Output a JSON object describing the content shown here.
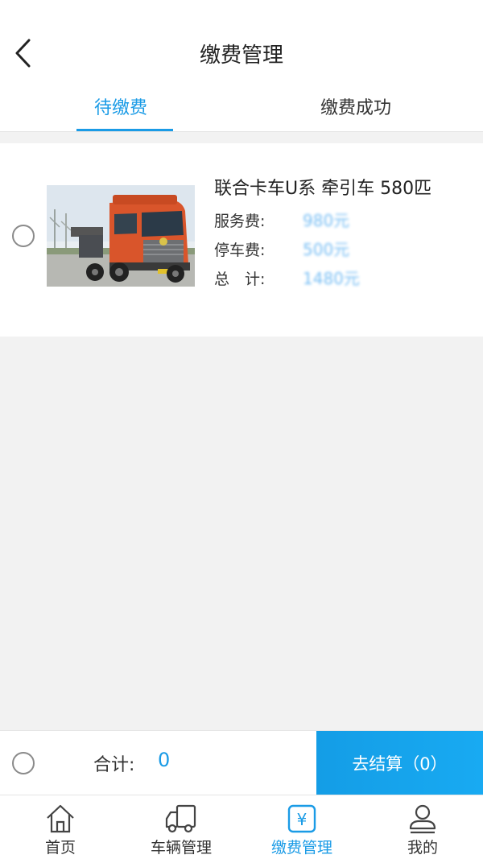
{
  "header": {
    "title": "缴费管理",
    "back_icon": "chevron-left-icon"
  },
  "tabs": [
    {
      "label": "待缴费",
      "active": true
    },
    {
      "label": "缴费成功",
      "active": false
    }
  ],
  "item": {
    "title": "联合卡车U系 牵引车 580匹",
    "image": "truck-photo",
    "fees": [
      {
        "label": "服务费:",
        "value": "980元"
      },
      {
        "label": "停车费:",
        "value": "500元"
      },
      {
        "label": "总　计:",
        "value": "1480元"
      }
    ]
  },
  "checkout": {
    "total_label": "合计:",
    "total_value": "0",
    "button_label": "去结算（0）"
  },
  "bottom_nav": [
    {
      "label": "首页",
      "icon": "home-icon"
    },
    {
      "label": "车辆管理",
      "icon": "truck-icon"
    },
    {
      "label": "缴费管理",
      "icon": "yen-icon",
      "active": true
    },
    {
      "label": "我的",
      "icon": "user-icon"
    }
  ],
  "colors": {
    "accent": "#1a9be6",
    "background": "#f2f2f2"
  }
}
